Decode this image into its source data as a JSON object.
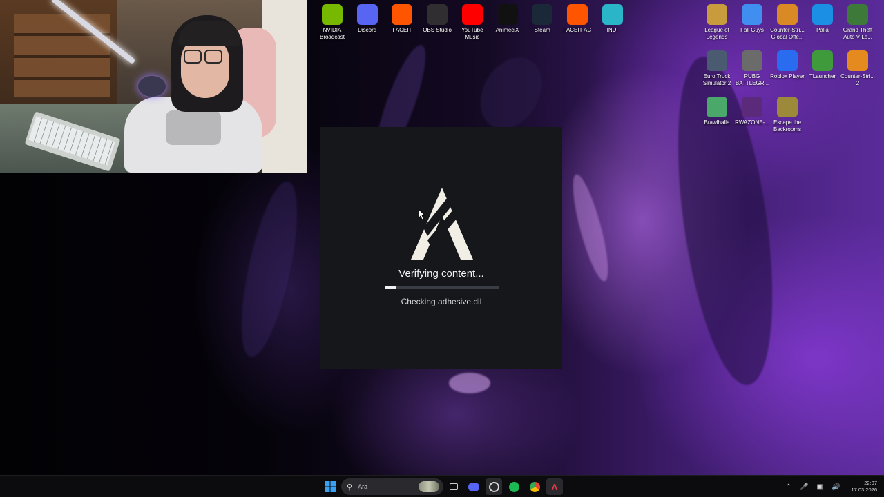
{
  "dialog": {
    "status_title": "Verifying content...",
    "status_detail": "Checking adhesive.dll",
    "progress_fraction": 0.1
  },
  "desktop_top_row": [
    {
      "label": "NVIDIA Broadcast",
      "icon": "nvidia-broadcast-icon",
      "color": "#76b900"
    },
    {
      "label": "Discord",
      "icon": "discord-icon",
      "color": "#5865f2"
    },
    {
      "label": "FACEIT",
      "icon": "faceit-icon",
      "color": "#ff5500"
    },
    {
      "label": "OBS Studio",
      "icon": "obs-studio-icon",
      "color": "#302e31"
    },
    {
      "label": "YouTube Music",
      "icon": "youtube-music-icon",
      "color": "#ff0000"
    },
    {
      "label": "AnimeciX",
      "icon": "animecix-icon",
      "color": "#111111"
    },
    {
      "label": "Steam",
      "icon": "steam-icon",
      "color": "#1b2838"
    },
    {
      "label": "FACEIT AC",
      "icon": "faceit-ac-icon",
      "color": "#ff5500"
    },
    {
      "label": "INUI",
      "icon": "inui-icon",
      "color": "#2bb5c8"
    }
  ],
  "desktop_right_grid": [
    {
      "label": "League of Legends",
      "icon": "league-of-legends-icon",
      "color": "#c89b3c"
    },
    {
      "label": "Fall Guys",
      "icon": "fall-guys-icon",
      "color": "#3f8ef0"
    },
    {
      "label": "Counter-Stri... Global Offe...",
      "icon": "csgo-icon",
      "color": "#d98a25"
    },
    {
      "label": "Palia",
      "icon": "palia-icon",
      "color": "#1a8fe3"
    },
    {
      "label": "Grand Theft Auto V Le...",
      "icon": "gta-v-icon",
      "color": "#3d7a3a"
    },
    {
      "label": "Euro Truck Simulator 2",
      "icon": "euro-truck-icon",
      "color": "#4a5a70"
    },
    {
      "label": "PUBG BATTLEGR...",
      "icon": "pubg-icon",
      "color": "#6b6b6b"
    },
    {
      "label": "Roblox Player",
      "icon": "roblox-icon",
      "color": "#2a6cf0"
    },
    {
      "label": "TLauncher",
      "icon": "tlauncher-icon",
      "color": "#3f9a3b"
    },
    {
      "label": "Counter-Stri... 2",
      "icon": "cs2-icon",
      "color": "#e58a1f"
    },
    {
      "label": "Brawlhalla",
      "icon": "brawlhalla-icon",
      "color": "#4aa86a"
    },
    {
      "label": "RWAZONE-...",
      "icon": "rwazone-icon",
      "color": "#5b2a7a"
    },
    {
      "label": "Escape the Backrooms",
      "icon": "escape-backrooms-icon",
      "color": "#9c8a3a"
    }
  ],
  "taskbar": {
    "search_placeholder": "Ara",
    "clock_time": "22:07",
    "clock_date": "17.03.2026"
  }
}
